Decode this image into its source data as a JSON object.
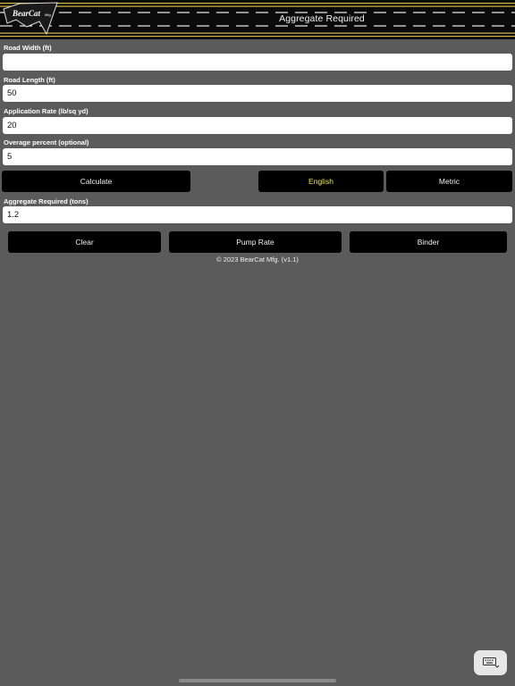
{
  "header": {
    "title": "Aggregate Required",
    "logo_text": "BearCat Mfg."
  },
  "form": {
    "road_width": {
      "label": "Road Width  (ft)",
      "value": ""
    },
    "road_length": {
      "label": "Road Length  (ft)",
      "value": "50"
    },
    "application_rate": {
      "label": "Application Rate  (lb/sq yd)",
      "value": "20"
    },
    "overage": {
      "label": "Overage percent (optional)",
      "value": "5"
    }
  },
  "actions": {
    "calculate": "Calculate",
    "english": "English",
    "metric": "Metric",
    "active_unit": "English"
  },
  "result": {
    "label": "Aggregate Required  (tons)",
    "value": "1.2"
  },
  "nav": {
    "clear": "Clear",
    "pump_rate": "Pump Rate",
    "binder": "Binder"
  },
  "footer": "© 2023 BearCat Mfg. (v1.1)",
  "icons": {
    "keyboard": "keyboard-icon"
  },
  "colors": {
    "background": "#5b5b5b",
    "button": "#000000",
    "active_text": "#e8e84a",
    "road_stripe": "#d9b84a"
  }
}
